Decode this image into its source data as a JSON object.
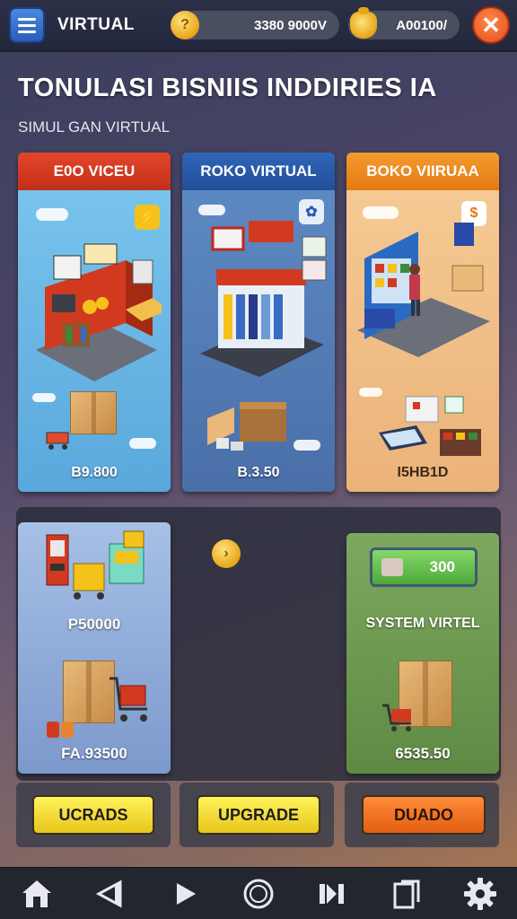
{
  "header": {
    "app_title": "VIRTUAL",
    "gold_value": "3380 9000V",
    "gems_value": "A00100/",
    "gold_icon": "coin-icon",
    "gems_icon": "money-bag-icon",
    "close_icon": "close-icon",
    "menu_icon": "menu-icon"
  },
  "main_title": "TONULASI BISNIIS INDDIRIES IA",
  "subtitle": "SIMUL GAN VIRTUAL",
  "shops": [
    {
      "title": "E0O VICEU",
      "price": "B9.800",
      "badge": "⚡"
    },
    {
      "title": "ROKO VIRTUAL",
      "price": "B.3.50"
    },
    {
      "title": "BOKO VIIRUAA",
      "price": "I5HB1D"
    }
  ],
  "items": {
    "left_label_top": "P50000",
    "left_label_bottom": "FA.93500",
    "mid_coin": "›",
    "right_chip": "300",
    "right_label": "SYSTEM VIRTEL",
    "right_price": "6535.50"
  },
  "buttons": {
    "upgrade_1": "UCRADS",
    "upgrade_2": "UPGRADE",
    "buy": "DUADO"
  },
  "nav": [
    "home-icon",
    "back-icon",
    "play-icon",
    "circle-icon",
    "skip-icon",
    "copy-icon",
    "settings-icon"
  ],
  "colors": {
    "shop1_header": "#e4452a",
    "shop2_header": "#2f66b8",
    "shop3_header": "#f59b2e",
    "button_yellow": "#f4e03a",
    "button_orange": "#f07a24"
  }
}
